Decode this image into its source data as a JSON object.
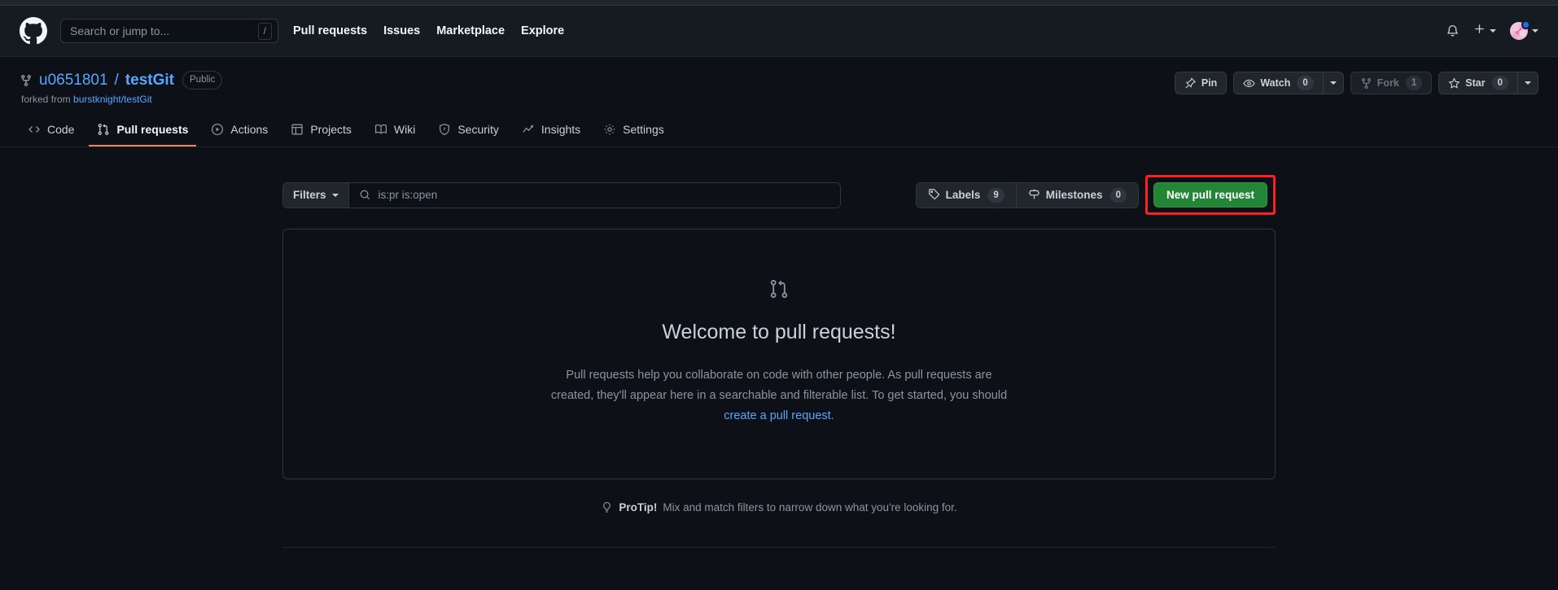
{
  "header": {
    "logo_icon": "github-mark-icon",
    "search": {
      "placeholder": "Search or jump to...",
      "shortcut_key": "/"
    },
    "nav": [
      {
        "label": "Pull requests"
      },
      {
        "label": "Issues"
      },
      {
        "label": "Marketplace"
      },
      {
        "label": "Explore"
      }
    ],
    "notifications_icon": "bell-icon",
    "create_new_icon": "plus-icon",
    "avatar_icon": "user-avatar",
    "status_dot_color": "#1f6feb"
  },
  "repo": {
    "fork_icon": "repo-forked-icon",
    "owner": "u0651801",
    "separator": "/",
    "name": "testGit",
    "visibility": "Public",
    "forked_from_label": "forked from",
    "forked_from_repo": "burstknight/testGit",
    "actions": {
      "pin": {
        "label": "Pin",
        "icon": "pin-icon"
      },
      "watch": {
        "label": "Watch",
        "count": "0",
        "icon": "eye-icon"
      },
      "fork": {
        "label": "Fork",
        "count": "1",
        "icon": "repo-forked-icon",
        "disabled": true
      },
      "star": {
        "label": "Star",
        "count": "0",
        "icon": "star-icon"
      }
    }
  },
  "tabs": [
    {
      "label": "Code",
      "icon": "code-icon",
      "active": false
    },
    {
      "label": "Pull requests",
      "icon": "git-pull-request-icon",
      "active": true
    },
    {
      "label": "Actions",
      "icon": "play-icon",
      "active": false
    },
    {
      "label": "Projects",
      "icon": "table-icon",
      "active": false
    },
    {
      "label": "Wiki",
      "icon": "book-icon",
      "active": false
    },
    {
      "label": "Security",
      "icon": "shield-icon",
      "active": false
    },
    {
      "label": "Insights",
      "icon": "graph-icon",
      "active": false
    },
    {
      "label": "Settings",
      "icon": "gear-icon",
      "active": false
    }
  ],
  "toolbar": {
    "filters_label": "Filters",
    "search_icon": "search-icon",
    "search_value": "is:pr is:open",
    "labels": {
      "label": "Labels",
      "count": "9",
      "icon": "tag-icon"
    },
    "milestones": {
      "label": "Milestones",
      "count": "0",
      "icon": "milestone-icon"
    },
    "new_pull_request": {
      "label": "New pull request",
      "color": "#238636"
    },
    "highlight_color": "#fc2121"
  },
  "blankslate": {
    "icon": "git-pull-request-icon",
    "title": "Welcome to pull requests!",
    "body_part1": "Pull requests help you collaborate on code with other people. As pull requests are created, they'll appear here in a searchable and filterable list. To get started, you should ",
    "body_link": "create a pull request",
    "body_part2": "."
  },
  "protip": {
    "icon": "lightbulb-icon",
    "label": "ProTip!",
    "text": "Mix and match filters to narrow down what you're looking for."
  }
}
